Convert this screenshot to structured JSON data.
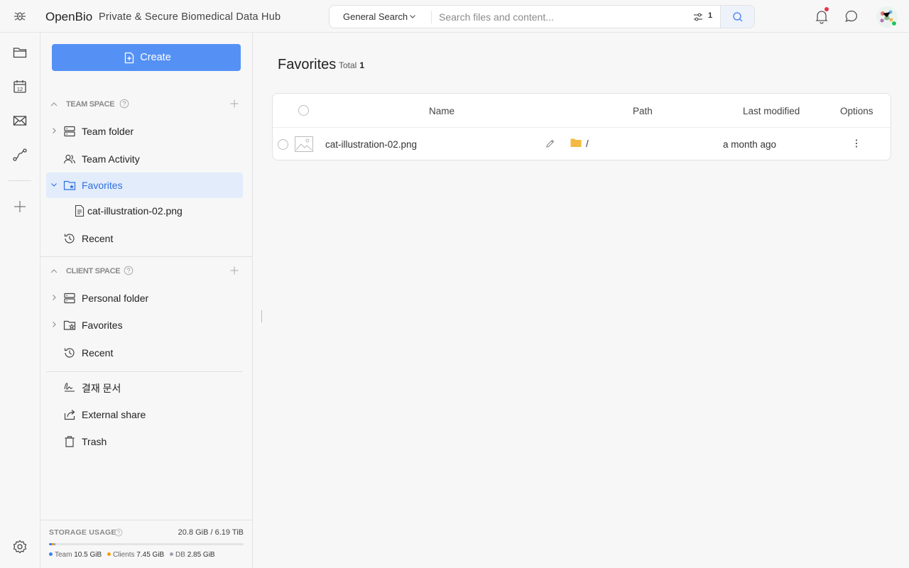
{
  "app": {
    "name": "OpenBio",
    "tagline": "Private & Secure Biomedical Data Hub"
  },
  "search": {
    "scope": "General Search",
    "placeholder": "Search files and content...",
    "filter_count": "1"
  },
  "sidebar": {
    "create_label": "Create",
    "team_space": {
      "title": "TEAM SPACE",
      "items": [
        {
          "label": "Team folder"
        },
        {
          "label": "Team Activity"
        },
        {
          "label": "Favorites"
        },
        {
          "label": "cat-illustration-02.png"
        },
        {
          "label": "Recent"
        }
      ]
    },
    "client_space": {
      "title": "CLIENT SPACE",
      "items": [
        {
          "label": "Personal folder"
        },
        {
          "label": "Favorites"
        },
        {
          "label": "Recent"
        }
      ]
    },
    "extra": [
      {
        "label": "결재 문서"
      },
      {
        "label": "External share"
      },
      {
        "label": "Trash"
      }
    ],
    "storage": {
      "title": "STORAGE USAGE",
      "total": "20.8 GiB / 6.19 TiB",
      "legend": [
        {
          "name": "Team",
          "value": "10.5 GiB",
          "color": "#3b82f6"
        },
        {
          "name": "Clients",
          "value": "7.45 GiB",
          "color": "#f59e0b"
        },
        {
          "name": "DB",
          "value": "2.85 GiB",
          "color": "#9ca3af"
        }
      ]
    }
  },
  "main": {
    "title": "Favorites",
    "total_label": "Total",
    "total_count": "1",
    "columns": [
      "Name",
      "Path",
      "Last modified",
      "Options"
    ],
    "rows": [
      {
        "name": "cat-illustration-02.png",
        "path": "/",
        "modified": "a month ago"
      }
    ]
  },
  "colors": {
    "accent": "#5591f5",
    "active_bg": "#e2ecfb",
    "notification_dot": "#e5344c",
    "online_dot": "#22c55e"
  },
  "icons": [
    "logo-icon",
    "chevron-down-icon",
    "filter-icon",
    "search-icon",
    "bell-icon",
    "chat-icon",
    "folder-icon",
    "calendar-icon",
    "mail-icon",
    "route-icon",
    "plus-icon",
    "settings-icon",
    "help-icon",
    "server-icon",
    "team-icon",
    "star-folder-icon",
    "file-icon",
    "history-icon",
    "signature-icon",
    "share-icon",
    "trash-icon",
    "image-icon",
    "edit-icon",
    "more-vertical-icon"
  ]
}
